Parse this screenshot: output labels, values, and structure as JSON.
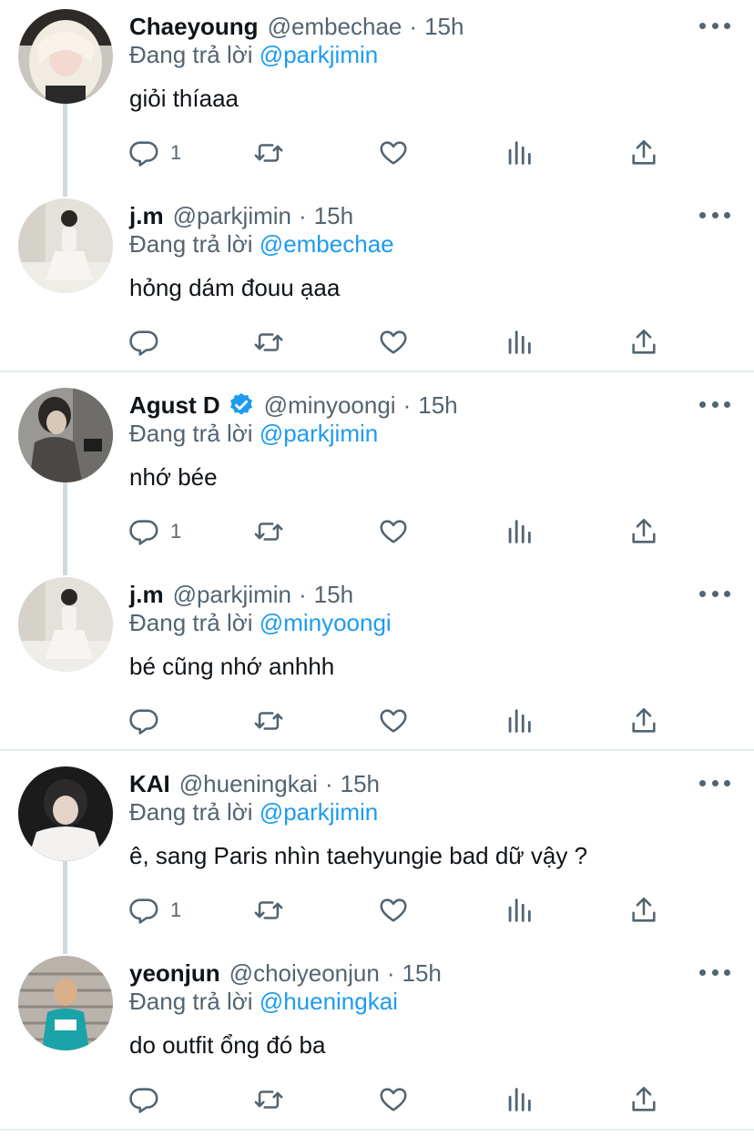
{
  "reply_prefix": "Đang trả lời",
  "colors": {
    "accent": "#1d9bf0",
    "secondary_text": "#536471",
    "primary_text": "#0f1419",
    "thread_line": "#cfd9de",
    "divider": "#e6ecf0"
  },
  "icons": {
    "reply": "reply-icon",
    "retweet": "retweet-icon",
    "like": "heart-icon",
    "views": "views-icon",
    "share": "share-icon",
    "more": "more-icon",
    "verified": "verified-badge-icon"
  },
  "tweets": [
    {
      "name": "Chaeyoung",
      "handle": "@embechae",
      "sep": "·",
      "time": "15h",
      "reply_to": "@parkjimin",
      "text": "giỏi thíaaa",
      "reply_count": "1",
      "verified": false
    },
    {
      "name": "j.m",
      "handle": "@parkjimin",
      "sep": "·",
      "time": "15h",
      "reply_to": "@embechae",
      "text": "hỏng dám đouu ạaa",
      "reply_count": "",
      "verified": false
    },
    {
      "name": "Agust D",
      "handle": "@minyoongi",
      "sep": "·",
      "time": "15h",
      "reply_to": "@parkjimin",
      "text": "nhớ bée",
      "reply_count": "1",
      "verified": true
    },
    {
      "name": "j.m",
      "handle": "@parkjimin",
      "sep": "·",
      "time": "15h",
      "reply_to": "@minyoongi",
      "text": "bé cũng nhớ anhhh",
      "reply_count": "",
      "verified": false
    },
    {
      "name": "KAI",
      "handle": "@hueningkai",
      "sep": "·",
      "time": "15h",
      "reply_to": "@parkjimin",
      "text": "ê, sang Paris nhìn taehyungie bad dữ vậy ?",
      "reply_count": "1",
      "verified": false
    },
    {
      "name": "yeonjun",
      "handle": "@choiyeonjun",
      "sep": "·",
      "time": "15h",
      "reply_to": "@hueningkai",
      "text": "do outfit ổng đó ba",
      "reply_count": "",
      "verified": false
    }
  ]
}
